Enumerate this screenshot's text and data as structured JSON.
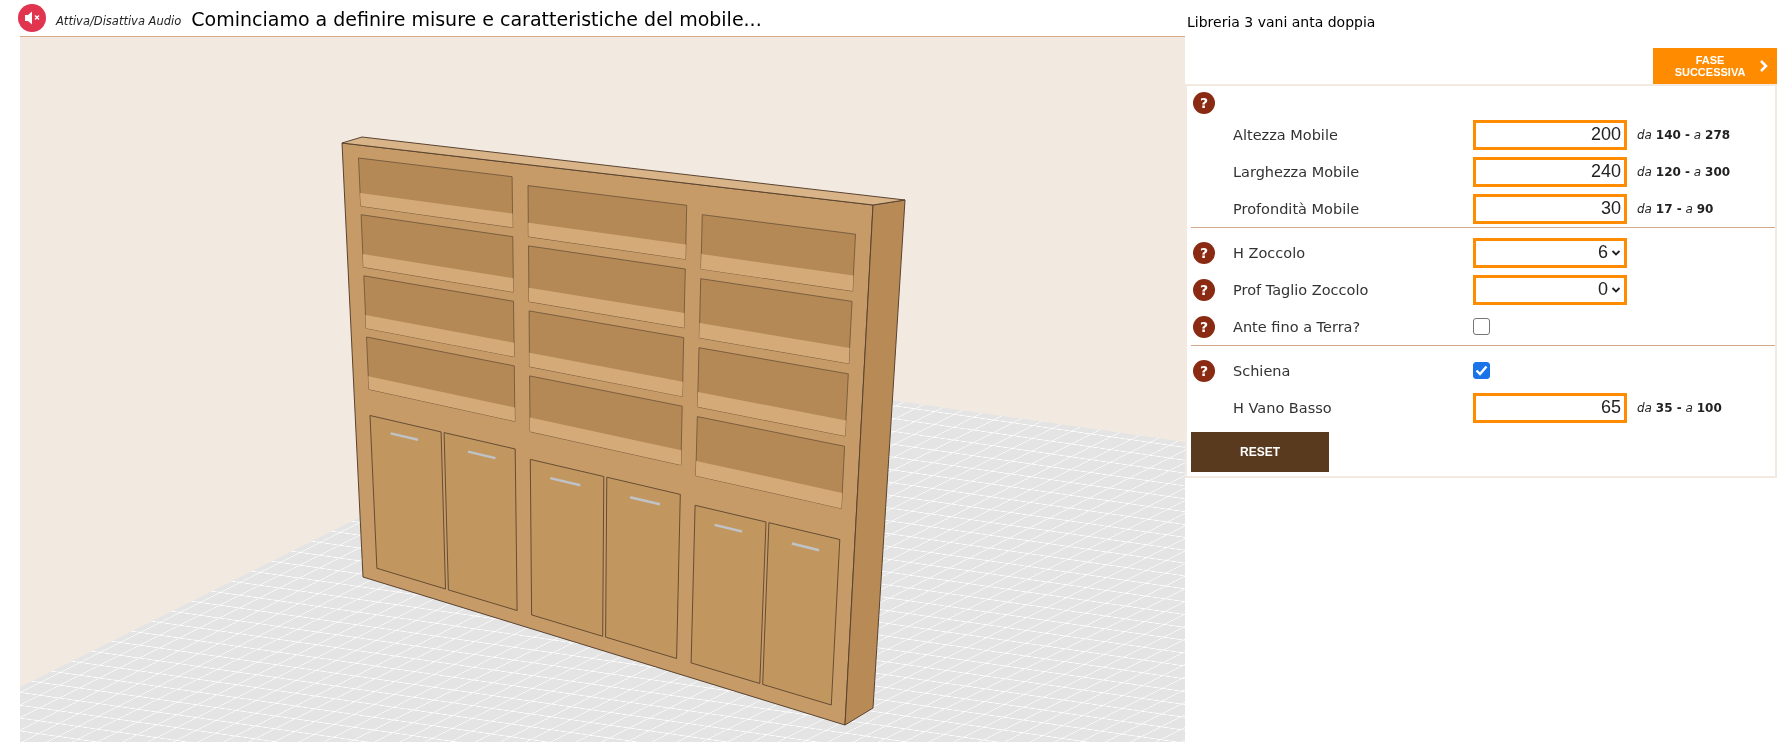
{
  "audio_toggle": {
    "label": "Attiva/Disattiva Audio",
    "muted": true
  },
  "title": "Cominciamo a definire misure e caratteristiche del mobile...",
  "product_name": "Libreria 3 vani anta doppia",
  "next_button": {
    "label": "FASE SUCCESSIVA"
  },
  "groups": [
    {
      "help": "?",
      "rows": [
        {
          "kind": "number",
          "label": "Altezza Mobile",
          "value": "200",
          "range": "*da* **140 -** *a* **278**"
        },
        {
          "kind": "number",
          "label": "Larghezza Mobile",
          "value": "240",
          "range": "*da* **120 -** *a* **300**"
        },
        {
          "kind": "number",
          "label": "Profondità Mobile",
          "value": "30",
          "range": "*da* **17 -** *a* **90**"
        }
      ]
    },
    {
      "rows": [
        {
          "kind": "select",
          "help": "?",
          "label": "H Zoccolo",
          "value": "6"
        },
        {
          "kind": "select",
          "help": "?",
          "label": "Prof Taglio Zoccolo",
          "value": "0"
        },
        {
          "kind": "checkbox",
          "help": "?",
          "label": "Ante fino a Terra?",
          "checked": false
        }
      ]
    },
    {
      "rows": [
        {
          "kind": "checkbox",
          "help": "?",
          "label": "Schiena",
          "checked": true
        },
        {
          "kind": "number",
          "label": "H Vano Basso",
          "value": "65",
          "range": "*da* **35 -** *a* **100**"
        }
      ]
    }
  ],
  "reset_button": {
    "label": "RESET"
  }
}
